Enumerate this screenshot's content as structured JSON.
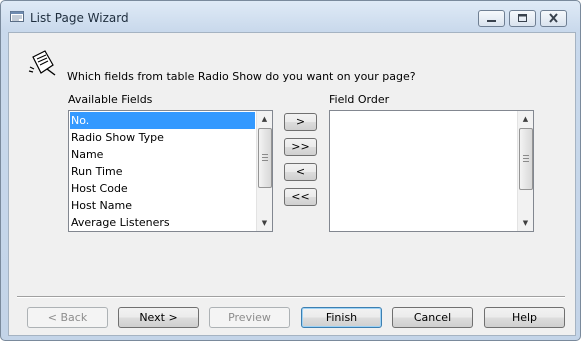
{
  "window": {
    "title": "List Page Wizard"
  },
  "prompt": "Which fields from table Radio Show do you want on your page?",
  "available": {
    "label": "Available Fields",
    "items": [
      "No.",
      "Radio Show Type",
      "Name",
      "Run Time",
      "Host Code",
      "Host Name",
      "Average Listeners"
    ],
    "selected_index": 0
  },
  "order": {
    "label": "Field Order",
    "items": []
  },
  "move_buttons": {
    "add": ">",
    "add_all": ">>",
    "remove": "<",
    "remove_all": "<<"
  },
  "footer": {
    "back": "< Back",
    "next": "Next >",
    "preview": "Preview",
    "finish": "Finish",
    "cancel": "Cancel",
    "help": "Help"
  },
  "colors": {
    "selection": "#3399ff",
    "title_bar": "#c9d9ec",
    "dialog_bg": "#f0f0f0"
  }
}
